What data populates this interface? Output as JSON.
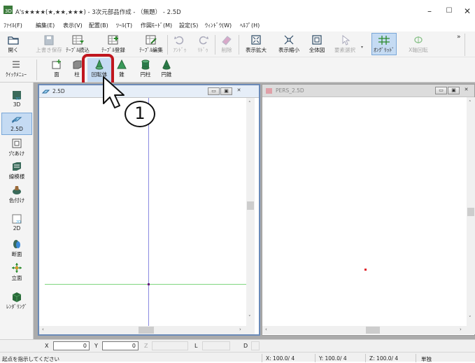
{
  "window": {
    "title": "A's★★★★(★,★★,★★★) - 3次元部品作成 - （無題） - 2.5D",
    "minimize": "–",
    "maximize": "☐",
    "close": "✕"
  },
  "menu": [
    "ﾌｧｲﾙ(F)",
    "編集(E)",
    "表示(V)",
    "配置(B)",
    "ﾂｰﾙ(T)",
    "作図ﾓｰﾄﾞ(M)",
    "設定(S)",
    "ｳｨﾝﾄﾞｳ(W)",
    "ﾍﾙﾌﾟ(H)"
  ],
  "toolbar1": {
    "items": [
      {
        "label": "開く",
        "icon": "folder-open-icon"
      },
      {
        "label": "上書き保存",
        "icon": "save-icon"
      },
      {
        "label": "ﾃｰﾌﾞﾙ読込",
        "icon": "table-load-icon"
      },
      {
        "label": "ﾃｰﾌﾞﾙ登録",
        "icon": "table-register-icon"
      },
      {
        "label": "ﾃｰﾌﾞﾙ編集",
        "icon": "table-edit-icon"
      },
      {
        "label": "ｱﾝﾄﾞｩ",
        "icon": "undo-icon"
      },
      {
        "label": "ﾘﾄﾞｩ",
        "icon": "redo-icon"
      },
      {
        "label": "削除",
        "icon": "eraser-icon"
      },
      {
        "label": "表示拡大",
        "icon": "zoom-in-icon"
      },
      {
        "label": "表示縮小",
        "icon": "zoom-out-icon"
      },
      {
        "label": "全体図",
        "icon": "fit-all-icon"
      },
      {
        "label": "要素選択",
        "icon": "select-arrow-icon"
      },
      {
        "label": "ｵﾝｸﾞﾘｯﾄﾞ",
        "icon": "grid-icon"
      },
      {
        "label": "X軸回転",
        "icon": "rotate-x-icon"
      }
    ],
    "overflow": "»"
  },
  "toolbar2": {
    "items": [
      {
        "label": "ｸｲｯｸﾒﾆｭｰ",
        "icon": "menu-icon"
      },
      {
        "label": "面",
        "icon": "face-icon"
      },
      {
        "label": "柱",
        "icon": "pillar-icon"
      },
      {
        "label": "回転体",
        "icon": "revolve-icon"
      },
      {
        "label": "錐",
        "icon": "cone-icon"
      },
      {
        "label": "円柱",
        "icon": "cylinder-icon"
      },
      {
        "label": "円錐",
        "icon": "circular-cone-icon"
      }
    ]
  },
  "sidebar": [
    {
      "label": "3D",
      "icon": "3d-view-icon"
    },
    {
      "label": "2.5D",
      "icon": "2.5d-view-icon"
    },
    {
      "label": "穴あけ",
      "icon": "hole-icon"
    },
    {
      "label": "線模様",
      "icon": "line-pattern-icon"
    },
    {
      "label": "色付け",
      "icon": "paint-icon"
    },
    {
      "label": "2D",
      "icon": "2d-view-icon"
    },
    {
      "label": "断面",
      "icon": "section-icon"
    },
    {
      "label": "立面",
      "icon": "elevation-icon"
    },
    {
      "label": "ﾚﾝﾀﾞﾘﾝｸﾞ",
      "icon": "rendering-icon"
    }
  ],
  "panels": {
    "left": {
      "title": "2.5D",
      "btn_min": "▭",
      "btn_max": "▣",
      "btn_close": "✕"
    },
    "right": {
      "title": "PERS_2.5D",
      "btn_min": "▭",
      "btn_max": "▣",
      "btn_close": "✕"
    }
  },
  "callout": {
    "number": "1"
  },
  "coords": {
    "x_label": "X",
    "x_value": "0",
    "y_label": "Y",
    "y_value": "0",
    "z_label": "Z",
    "l_label": "L",
    "d_label": "D"
  },
  "status": {
    "message": "起点を指示してください",
    "x": "X: 100.0/ 4",
    "y": "Y: 100.0/ 4",
    "z": "Z: 100.0/ 4",
    "mode": "単独"
  },
  "colors": {
    "highlight_border": "#c0161e",
    "active_tool_bg": "#c5dbf3",
    "axis_vertical": "#8a8ae0",
    "axis_horizontal": "#7fd67f",
    "origin_point": "#6a1a7a",
    "pers_point": "#e0202a"
  }
}
